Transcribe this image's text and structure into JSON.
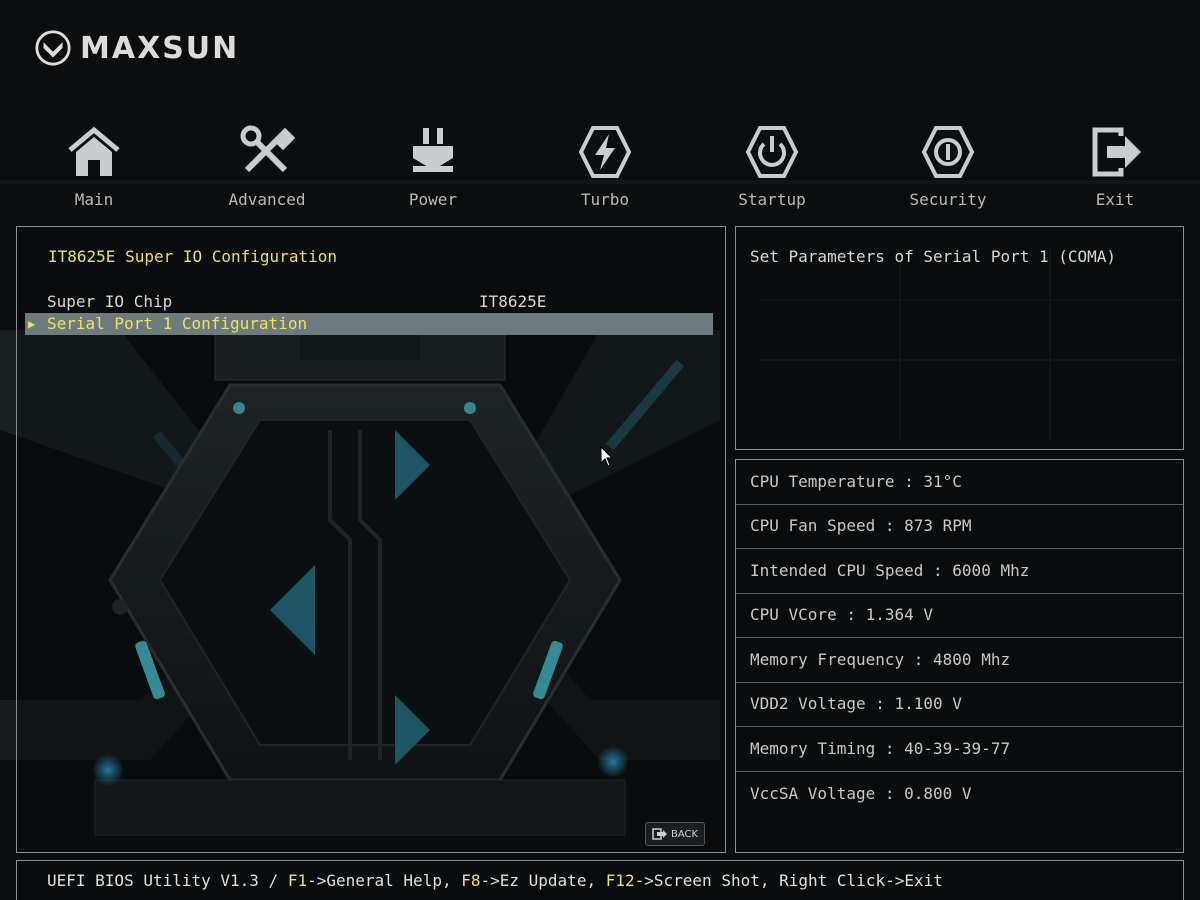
{
  "brand": {
    "name": "MAXSUN"
  },
  "nav": {
    "items": [
      {
        "label": "Main",
        "icon": "home-icon"
      },
      {
        "label": "Advanced",
        "icon": "tools-icon"
      },
      {
        "label": "Power",
        "icon": "power-plug-icon"
      },
      {
        "label": "Turbo",
        "icon": "turbo-bolt-icon"
      },
      {
        "label": "Startup",
        "icon": "power-button-icon"
      },
      {
        "label": "Security",
        "icon": "shield-icon"
      },
      {
        "label": "Exit",
        "icon": "exit-icon"
      }
    ]
  },
  "page": {
    "title": "IT8625E Super IO Configuration",
    "rows": [
      {
        "label": "Super IO Chip",
        "value": "IT8625E"
      },
      {
        "label": "Serial Port 1 Configuration",
        "value": "",
        "selected": true
      }
    ],
    "back_label": "BACK"
  },
  "help": {
    "text": "Set Parameters of Serial Port 1 (COMA)"
  },
  "status": {
    "items": [
      "CPU Temperature : 31°C",
      "CPU Fan Speed : 873 RPM",
      "Intended CPU Speed : 6000 Mhz",
      "CPU VCore : 1.364 V",
      "Memory Frequency : 4800 Mhz",
      "VDD2 Voltage : 1.100 V",
      "Memory Timing : 40-39-39-77",
      "VccSA Voltage : 0.800 V"
    ]
  },
  "footer": {
    "prefix": "UEFI BIOS Utility V1.3 / ",
    "f1_key": "F1",
    "f1_text": "->General Help, ",
    "f8_key": "F8",
    "f8_text": "->Ez Update, ",
    "f12_key": "F12",
    "f12_text": "->Screen Shot, Right Click->Exit"
  },
  "colors": {
    "accent_yellow": "#f0e05a",
    "selection_bg": "#6c7c7e",
    "panel_border": "#8a8f92",
    "background": "#0b0d0e"
  }
}
